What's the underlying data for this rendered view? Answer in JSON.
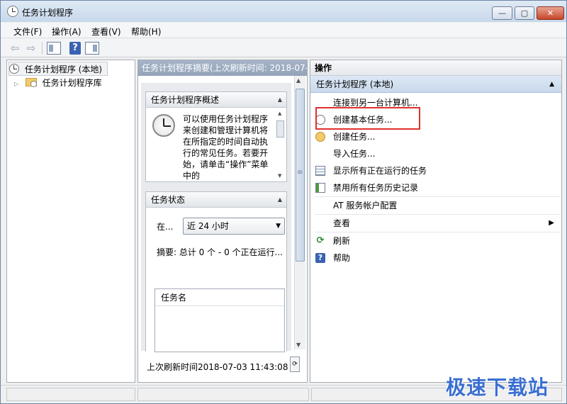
{
  "window": {
    "title": "任务计划程序",
    "buttons": {
      "minimize": "—",
      "maximize": "▢",
      "close": "✕"
    }
  },
  "menu": [
    "文件(F)",
    "操作(A)",
    "查看(V)",
    "帮助(H)"
  ],
  "toolbar": {
    "back": "⇦",
    "forward": "⇨",
    "help": "?"
  },
  "tree": {
    "root": "任务计划程序 (本地)",
    "child": "任务计划程序库"
  },
  "middle": {
    "header": "任务计划程序摘要(上次刷新时间: 2018-07-0",
    "overview": {
      "title": "任务计划程序概述",
      "text": "可以使用任务计划程序来创建和管理计算机将在所指定的时间自动执行的常见任务。若要开始，请单击“操作”菜单中的"
    },
    "status": {
      "title": "任务状态",
      "label": "在...",
      "select_value": "近 24 小时",
      "summary": "摘要: 总计 0 个 - 0 个正在运行...",
      "column": "任务名"
    },
    "footer": "上次刷新时间2018-07-03 11:43:08"
  },
  "actions": {
    "title": "操作",
    "group": "任务计划程序 (本地)",
    "items": [
      "连接到另一台计算机...",
      "创建基本任务...",
      "创建任务...",
      "导入任务...",
      "显示所有正在运行的任务",
      "禁用所有任务历史记录",
      "AT 服务帐户配置",
      "查看",
      "刷新",
      "帮助"
    ]
  },
  "watermark": "极速下载站",
  "colors": {
    "highlight": "#e0312c",
    "accent": "#3a6fd0"
  }
}
